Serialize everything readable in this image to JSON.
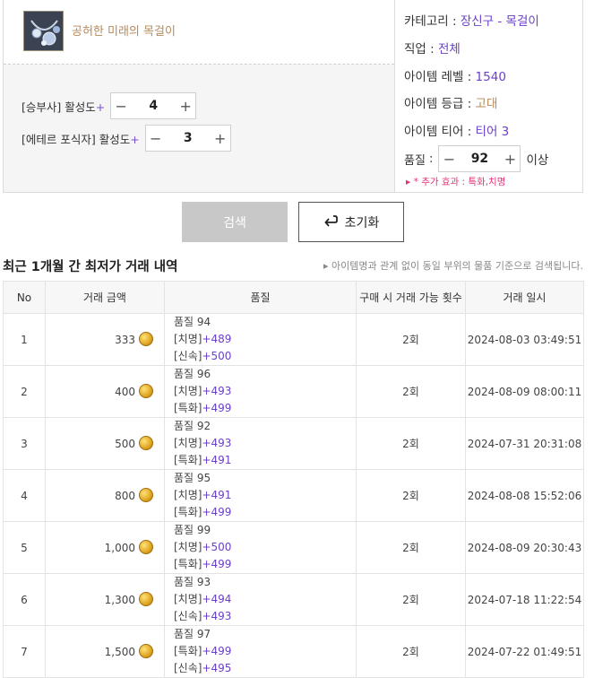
{
  "item": {
    "name": "공허한 미래의 목걸이",
    "icon": "necklace-icon"
  },
  "engravings": [
    {
      "label": "[승부사]",
      "suffix": "활성도",
      "plus": "+",
      "value": "4"
    },
    {
      "label": "[에테르 포식자]",
      "suffix": "활성도",
      "plus": "+",
      "value": "3"
    }
  ],
  "info": {
    "category_label": "카테고리",
    "category_value": "장신구 - 목걸이",
    "class_label": "직업",
    "class_value": "전체",
    "level_label": "아이템 레벨",
    "level_value": "1540",
    "grade_label": "아이템 등급",
    "grade_value": "고대",
    "tier_label": "아이템 티어",
    "tier_value": "티어 3",
    "quality_label": "품질",
    "quality_value": "92",
    "quality_suffix": "이상",
    "bonus": "* 추가 효과 : 특화,치명"
  },
  "buttons": {
    "search": "검색",
    "reset": "초기화"
  },
  "history": {
    "title": "최근 1개월 간 최저가 거래 내역",
    "note": "아이템명과 관계 없이 동일 부위의 물품 기준으로 검색됩니다.",
    "columns": [
      "No",
      "거래 금액",
      "품질",
      "구매 시 거래 가능 횟수",
      "거래 일시"
    ],
    "rows": [
      {
        "no": "1",
        "price": "333",
        "quality": "품질 94",
        "s1": "[치명]",
        "v1": "+489",
        "s2": "[신속]",
        "v2": "+500",
        "count": "2회",
        "date": "2024-08-03 03:49:51"
      },
      {
        "no": "2",
        "price": "400",
        "quality": "품질 96",
        "s1": "[치명]",
        "v1": "+493",
        "s2": "[특화]",
        "v2": "+499",
        "count": "2회",
        "date": "2024-08-09 08:00:11"
      },
      {
        "no": "3",
        "price": "500",
        "quality": "품질 92",
        "s1": "[치명]",
        "v1": "+493",
        "s2": "[특화]",
        "v2": "+491",
        "count": "2회",
        "date": "2024-07-31 20:31:08"
      },
      {
        "no": "4",
        "price": "800",
        "quality": "품질 95",
        "s1": "[치명]",
        "v1": "+491",
        "s2": "[특화]",
        "v2": "+499",
        "count": "2회",
        "date": "2024-08-08 15:52:06"
      },
      {
        "no": "5",
        "price": "1,000",
        "quality": "품질 99",
        "s1": "[치명]",
        "v1": "+500",
        "s2": "[특화]",
        "v2": "+499",
        "count": "2회",
        "date": "2024-08-09 20:30:43"
      },
      {
        "no": "6",
        "price": "1,300",
        "quality": "품질 93",
        "s1": "[치명]",
        "v1": "+494",
        "s2": "[신속]",
        "v2": "+493",
        "count": "2회",
        "date": "2024-07-18 11:22:54"
      },
      {
        "no": "7",
        "price": "1,500",
        "quality": "품질 97",
        "s1": "[특화]",
        "v1": "+499",
        "s2": "[신속]",
        "v2": "+495",
        "count": "2회",
        "date": "2024-07-22 01:49:51"
      }
    ]
  },
  "colors": {
    "accent": "#6b3fc8",
    "grade": "#b8895a",
    "bonus": "#e3317a"
  }
}
